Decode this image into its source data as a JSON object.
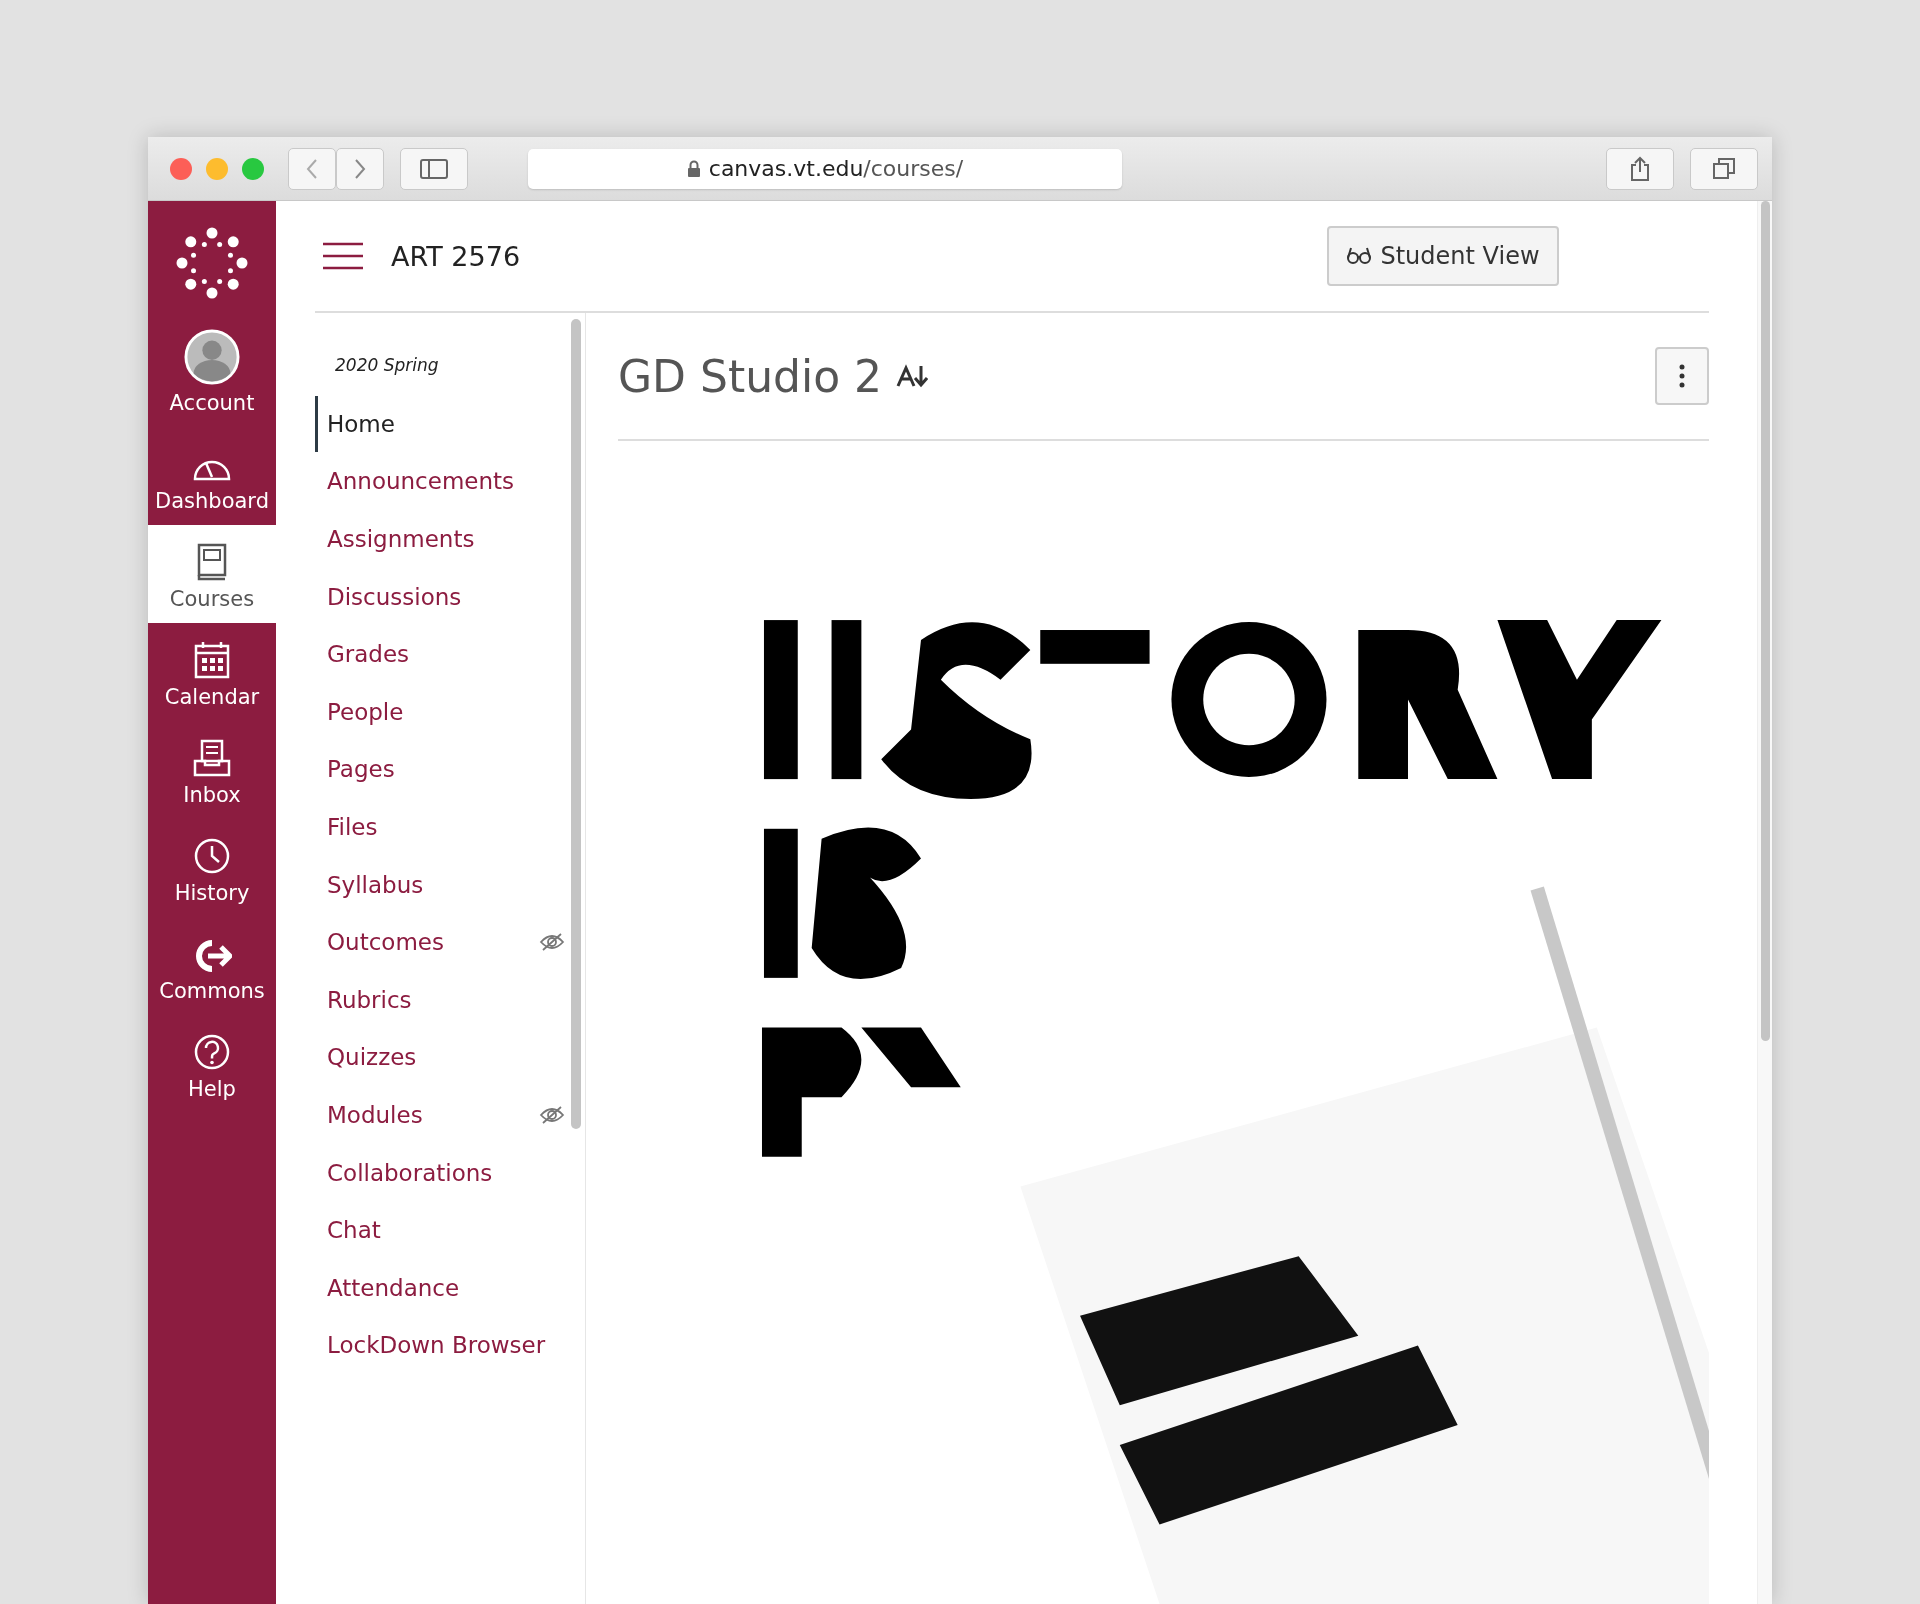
{
  "browser": {
    "url_host": "canvas.vt.edu",
    "url_path": "/courses/"
  },
  "global_nav": [
    {
      "label": "Account",
      "selected": false
    },
    {
      "label": "Dashboard",
      "selected": false
    },
    {
      "label": "Courses",
      "selected": true
    },
    {
      "label": "Calendar",
      "selected": false
    },
    {
      "label": "Inbox",
      "selected": false
    },
    {
      "label": "History",
      "selected": false
    },
    {
      "label": "Commons",
      "selected": false
    },
    {
      "label": "Help",
      "selected": false
    }
  ],
  "header": {
    "course_code": "ART 2576",
    "student_view_button": "Student View"
  },
  "course_nav": {
    "term": "2020 Spring",
    "items": [
      {
        "label": "Home",
        "selected": true,
        "hidden": false
      },
      {
        "label": "Announcements",
        "selected": false,
        "hidden": false
      },
      {
        "label": "Assignments",
        "selected": false,
        "hidden": false
      },
      {
        "label": "Discussions",
        "selected": false,
        "hidden": false
      },
      {
        "label": "Grades",
        "selected": false,
        "hidden": false
      },
      {
        "label": "People",
        "selected": false,
        "hidden": false
      },
      {
        "label": "Pages",
        "selected": false,
        "hidden": false
      },
      {
        "label": "Files",
        "selected": false,
        "hidden": false
      },
      {
        "label": "Syllabus",
        "selected": false,
        "hidden": false
      },
      {
        "label": "Outcomes",
        "selected": false,
        "hidden": true
      },
      {
        "label": "Rubrics",
        "selected": false,
        "hidden": false
      },
      {
        "label": "Quizzes",
        "selected": false,
        "hidden": false
      },
      {
        "label": "Modules",
        "selected": false,
        "hidden": true
      },
      {
        "label": "Collaborations",
        "selected": false,
        "hidden": false
      },
      {
        "label": "Chat",
        "selected": false,
        "hidden": false
      },
      {
        "label": "Attendance",
        "selected": false,
        "hidden": false
      },
      {
        "label": "LockDown Browser",
        "selected": false,
        "hidden": false
      }
    ]
  },
  "content": {
    "title": "GD Studio 2"
  }
}
